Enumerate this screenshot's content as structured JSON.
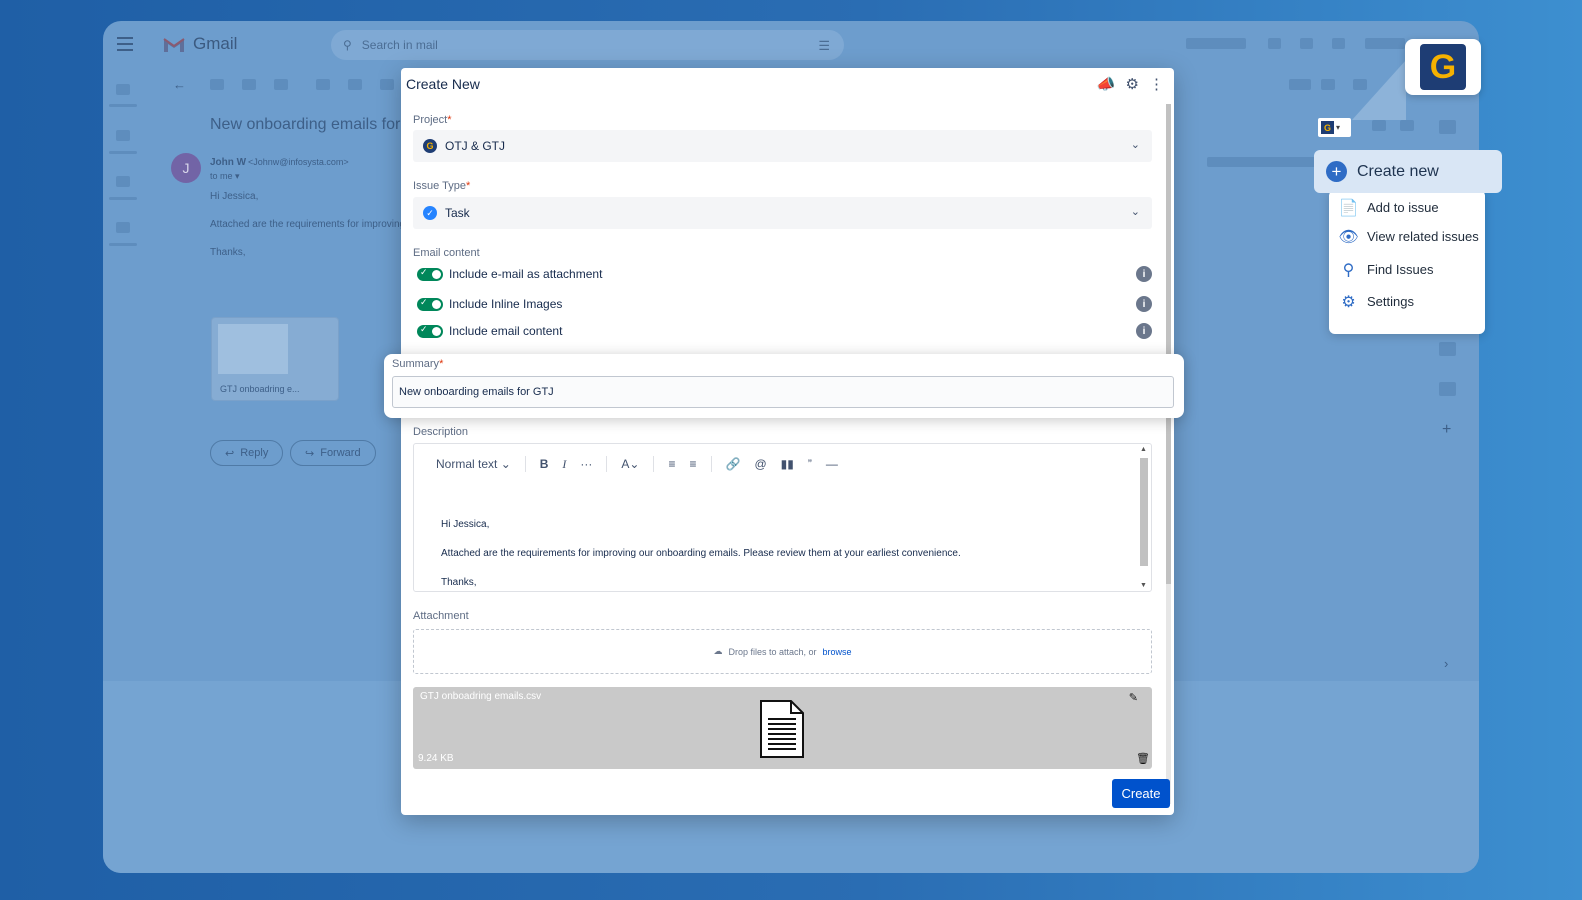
{
  "gmail": {
    "app_name": "Gmail",
    "search_placeholder": "Search in mail",
    "subject": "New onboarding emails for",
    "sender_name": "John W",
    "sender_email": "<Johnw@infosysta.com>",
    "to_line": "to me ▾",
    "avatar_initial": "J",
    "body_greeting": "Hi Jessica,",
    "body_line": "Attached are the requirements for improving ou",
    "body_signoff": "Thanks,",
    "attachment_name": "GTJ onboadring e...",
    "reply_label": "Reply",
    "forward_label": "Forward"
  },
  "dialog": {
    "title": "Create New",
    "project_label": "Project",
    "project_value": "OTJ & GTJ",
    "issue_type_label": "Issue Type",
    "issue_type_value": "Task",
    "email_content_label": "Email content",
    "toggles": [
      {
        "label": "Include e-mail as attachment",
        "on": true
      },
      {
        "label": "Include Inline Images",
        "on": true
      },
      {
        "label": "Include email content",
        "on": true
      }
    ],
    "summary_label": "Summary",
    "summary_value": "New onboarding emails for GTJ",
    "description_label": "Description",
    "toolbar": {
      "text_style": "Normal text",
      "bold": "B",
      "italic": "I",
      "more": "···"
    },
    "description_lines": [
      "Hi Jessica,",
      "Attached are the requirements for improving our onboarding emails. Please review them at your earliest convenience.",
      "Thanks,"
    ],
    "attachment_label": "Attachment",
    "dropzone_text": "Drop files to attach, or",
    "dropzone_link": "browse",
    "file_name": "GTJ onboadring emails.csv",
    "file_size": "9.24 KB",
    "create_button": "Create"
  },
  "extension_menu": {
    "header": "Create new",
    "items": [
      {
        "label": "Add to issue",
        "icon": "add-to-issue-icon"
      },
      {
        "label": "View related issues",
        "icon": "eye-icon"
      },
      {
        "label": "Find Issues",
        "icon": "search-icon"
      },
      {
        "label": "Settings",
        "icon": "gear-icon"
      }
    ]
  },
  "colors": {
    "primary": "#0052cc",
    "toggle_on": "#00875a",
    "brand_navy": "#1e3d74",
    "brand_gold": "#f5b100"
  }
}
